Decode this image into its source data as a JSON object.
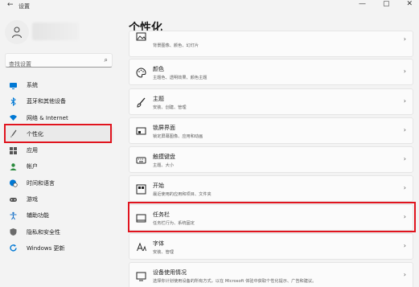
{
  "window": {
    "back_glyph": "←",
    "title": "设置",
    "minimize": "—",
    "maximize": "▢",
    "close": "✕"
  },
  "search": {
    "placeholder": "查找设置"
  },
  "nav": [
    {
      "label": "系统",
      "icon": "monitor-icon",
      "color": "#0078d4"
    },
    {
      "label": "蓝牙和其他设备",
      "icon": "bluetooth-icon",
      "color": "#0078d4"
    },
    {
      "label": "网络 & Internet",
      "icon": "wifi-icon",
      "color": "#0078d4"
    },
    {
      "label": "个性化",
      "icon": "brush-icon",
      "color": "#555555",
      "active": true
    },
    {
      "label": "应用",
      "icon": "apps-icon",
      "color": "#555555"
    },
    {
      "label": "帐户",
      "icon": "person-icon",
      "color": "#2b8a3e"
    },
    {
      "label": "时间和语言",
      "icon": "globe-clock-icon",
      "color": "#0078d4"
    },
    {
      "label": "游戏",
      "icon": "gamepad-icon",
      "color": "#555555"
    },
    {
      "label": "辅助功能",
      "icon": "accessibility-icon",
      "color": "#1a73c9"
    },
    {
      "label": "隐私和安全性",
      "icon": "shield-icon",
      "color": "#555555"
    },
    {
      "label": "Windows 更新",
      "icon": "update-icon",
      "color": "#0078d4"
    }
  ],
  "page": {
    "title": "个性化"
  },
  "cards": [
    {
      "title": "",
      "subtitle": "背景图像、颜色、幻灯片",
      "icon": "image-icon"
    },
    {
      "title": "颜色",
      "subtitle": "主题色、透明效果、颜色主题",
      "icon": "palette-icon"
    },
    {
      "title": "主题",
      "subtitle": "安装、创建、管理",
      "icon": "brush-theme-icon"
    },
    {
      "title": "锁屏界面",
      "subtitle": "锁定屏幕图像、应用和动画",
      "icon": "lock-screen-icon"
    },
    {
      "title": "触摸键盘",
      "subtitle": "主题、大小",
      "icon": "keyboard-icon"
    },
    {
      "title": "开始",
      "subtitle": "最近使用的应用和项目、文件夹",
      "icon": "start-icon"
    },
    {
      "title": "任务栏",
      "subtitle": "任务栏行为、系统固定",
      "icon": "taskbar-icon"
    },
    {
      "title": "字体",
      "subtitle": "安装、管理",
      "icon": "font-icon"
    },
    {
      "title": "设备使用情况",
      "subtitle": "选择你计划使用设备的所有方式，以在 Microsoft 体验中获取个性化提示、广告和建议。",
      "icon": "device-usage-icon"
    }
  ],
  "highlight_color": "#e0141e"
}
